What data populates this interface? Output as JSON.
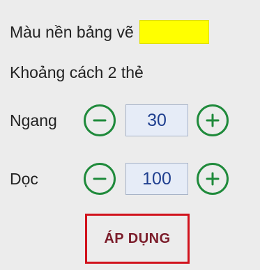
{
  "background": {
    "label": "Màu nền bảng vẽ",
    "color": "#ffff00"
  },
  "spacing": {
    "label": "Khoảng cách 2 thẻ",
    "horizontal": {
      "label": "Ngang",
      "value": "30",
      "decrement_icon": "minus-circle-icon",
      "increment_icon": "plus-circle-icon"
    },
    "vertical": {
      "label": "Dọc",
      "value": "100",
      "decrement_icon": "minus-circle-icon",
      "increment_icon": "plus-circle-icon"
    }
  },
  "apply_button": {
    "label": "ÁP DỤNG",
    "border_color": "#d1121c",
    "text_color": "#7b1c2a"
  },
  "colors": {
    "panel_bg": "#ececec",
    "stepper_green": "#1f8a3b",
    "value_text": "#1f3f8f",
    "value_bg": "#e6ecf7"
  }
}
